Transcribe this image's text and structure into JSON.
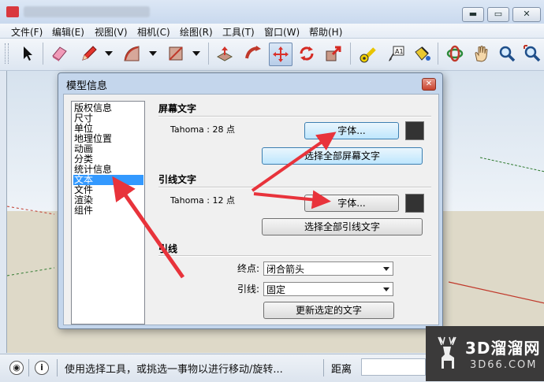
{
  "window": {
    "controls": {
      "minimize": "▬",
      "maximize": "▭",
      "close": "✕"
    }
  },
  "menu": [
    "文件(F)",
    "编辑(E)",
    "视图(V)",
    "相机(C)",
    "绘图(R)",
    "工具(T)",
    "窗口(W)",
    "帮助(H)"
  ],
  "toolbar": {
    "tools": [
      "select-arrow-icon",
      "eraser-icon",
      "pencil-icon",
      "arc-icon",
      "rectangle-icon",
      "push-pull-icon",
      "follow-me-icon",
      "move-icon",
      "rotate-icon",
      "scale-icon",
      "tape-measure-icon",
      "text-icon",
      "paint-bucket-icon",
      "orbit-icon",
      "pan-hand-icon",
      "zoom-icon",
      "zoom-extents-icon"
    ]
  },
  "dialog": {
    "title": "模型信息",
    "close": "✕",
    "categories": [
      "版权信息",
      "尺寸",
      "单位",
      "地理位置",
      "动画",
      "分类",
      "统计信息",
      "文本",
      "文件",
      "渲染",
      "组件"
    ],
    "selected_category": "文本",
    "screen_text": {
      "heading": "屏幕文字",
      "font_info": "Tahoma : 28 点",
      "font_button": "字体...",
      "select_all_button": "选择全部屏幕文字",
      "color": "#333333"
    },
    "leader_text": {
      "heading": "引线文字",
      "font_info": "Tahoma : 12 点",
      "font_button": "字体...",
      "select_all_button": "选择全部引线文字",
      "color": "#333333"
    },
    "leader_lines": {
      "heading": "引线",
      "endpoint_label": "终点:",
      "endpoint_value": "闭合箭头",
      "leader_label": "引线:",
      "leader_value": "固定",
      "update_button": "更新选定的文字"
    }
  },
  "statusbar": {
    "message": "使用选择工具，或挑选一事物以进行移动/旋转...",
    "distance_label": "距离"
  },
  "watermark": {
    "big": "3D溜溜网",
    "small": "3D66.COM"
  },
  "annotation_color": "#e8333b"
}
